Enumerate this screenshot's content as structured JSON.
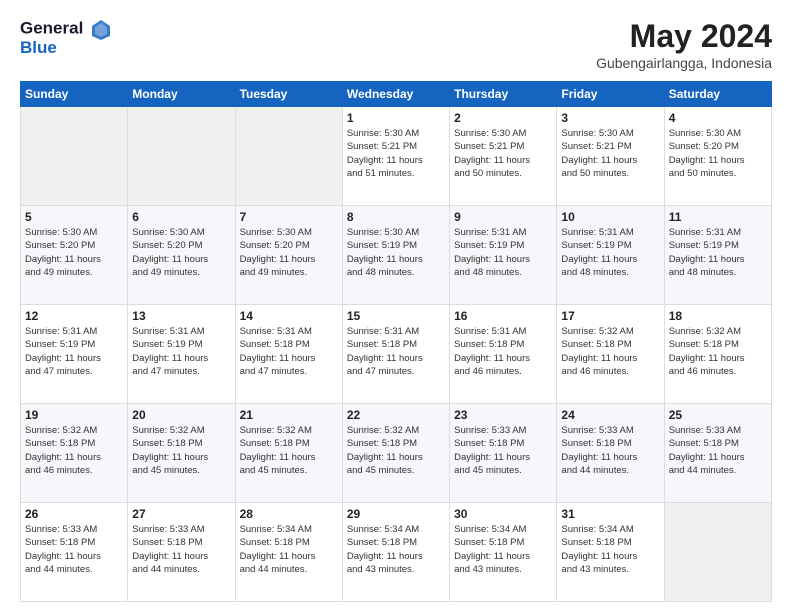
{
  "header": {
    "logo_line1": "General",
    "logo_line2": "Blue",
    "month_year": "May 2024",
    "location": "Gubengairlangga, Indonesia"
  },
  "weekdays": [
    "Sunday",
    "Monday",
    "Tuesday",
    "Wednesday",
    "Thursday",
    "Friday",
    "Saturday"
  ],
  "weeks": [
    [
      {
        "day": "",
        "info": ""
      },
      {
        "day": "",
        "info": ""
      },
      {
        "day": "",
        "info": ""
      },
      {
        "day": "1",
        "info": "Sunrise: 5:30 AM\nSunset: 5:21 PM\nDaylight: 11 hours\nand 51 minutes."
      },
      {
        "day": "2",
        "info": "Sunrise: 5:30 AM\nSunset: 5:21 PM\nDaylight: 11 hours\nand 50 minutes."
      },
      {
        "day": "3",
        "info": "Sunrise: 5:30 AM\nSunset: 5:21 PM\nDaylight: 11 hours\nand 50 minutes."
      },
      {
        "day": "4",
        "info": "Sunrise: 5:30 AM\nSunset: 5:20 PM\nDaylight: 11 hours\nand 50 minutes."
      }
    ],
    [
      {
        "day": "5",
        "info": "Sunrise: 5:30 AM\nSunset: 5:20 PM\nDaylight: 11 hours\nand 49 minutes."
      },
      {
        "day": "6",
        "info": "Sunrise: 5:30 AM\nSunset: 5:20 PM\nDaylight: 11 hours\nand 49 minutes."
      },
      {
        "day": "7",
        "info": "Sunrise: 5:30 AM\nSunset: 5:20 PM\nDaylight: 11 hours\nand 49 minutes."
      },
      {
        "day": "8",
        "info": "Sunrise: 5:30 AM\nSunset: 5:19 PM\nDaylight: 11 hours\nand 48 minutes."
      },
      {
        "day": "9",
        "info": "Sunrise: 5:31 AM\nSunset: 5:19 PM\nDaylight: 11 hours\nand 48 minutes."
      },
      {
        "day": "10",
        "info": "Sunrise: 5:31 AM\nSunset: 5:19 PM\nDaylight: 11 hours\nand 48 minutes."
      },
      {
        "day": "11",
        "info": "Sunrise: 5:31 AM\nSunset: 5:19 PM\nDaylight: 11 hours\nand 48 minutes."
      }
    ],
    [
      {
        "day": "12",
        "info": "Sunrise: 5:31 AM\nSunset: 5:19 PM\nDaylight: 11 hours\nand 47 minutes."
      },
      {
        "day": "13",
        "info": "Sunrise: 5:31 AM\nSunset: 5:19 PM\nDaylight: 11 hours\nand 47 minutes."
      },
      {
        "day": "14",
        "info": "Sunrise: 5:31 AM\nSunset: 5:18 PM\nDaylight: 11 hours\nand 47 minutes."
      },
      {
        "day": "15",
        "info": "Sunrise: 5:31 AM\nSunset: 5:18 PM\nDaylight: 11 hours\nand 47 minutes."
      },
      {
        "day": "16",
        "info": "Sunrise: 5:31 AM\nSunset: 5:18 PM\nDaylight: 11 hours\nand 46 minutes."
      },
      {
        "day": "17",
        "info": "Sunrise: 5:32 AM\nSunset: 5:18 PM\nDaylight: 11 hours\nand 46 minutes."
      },
      {
        "day": "18",
        "info": "Sunrise: 5:32 AM\nSunset: 5:18 PM\nDaylight: 11 hours\nand 46 minutes."
      }
    ],
    [
      {
        "day": "19",
        "info": "Sunrise: 5:32 AM\nSunset: 5:18 PM\nDaylight: 11 hours\nand 46 minutes."
      },
      {
        "day": "20",
        "info": "Sunrise: 5:32 AM\nSunset: 5:18 PM\nDaylight: 11 hours\nand 45 minutes."
      },
      {
        "day": "21",
        "info": "Sunrise: 5:32 AM\nSunset: 5:18 PM\nDaylight: 11 hours\nand 45 minutes."
      },
      {
        "day": "22",
        "info": "Sunrise: 5:32 AM\nSunset: 5:18 PM\nDaylight: 11 hours\nand 45 minutes."
      },
      {
        "day": "23",
        "info": "Sunrise: 5:33 AM\nSunset: 5:18 PM\nDaylight: 11 hours\nand 45 minutes."
      },
      {
        "day": "24",
        "info": "Sunrise: 5:33 AM\nSunset: 5:18 PM\nDaylight: 11 hours\nand 44 minutes."
      },
      {
        "day": "25",
        "info": "Sunrise: 5:33 AM\nSunset: 5:18 PM\nDaylight: 11 hours\nand 44 minutes."
      }
    ],
    [
      {
        "day": "26",
        "info": "Sunrise: 5:33 AM\nSunset: 5:18 PM\nDaylight: 11 hours\nand 44 minutes."
      },
      {
        "day": "27",
        "info": "Sunrise: 5:33 AM\nSunset: 5:18 PM\nDaylight: 11 hours\nand 44 minutes."
      },
      {
        "day": "28",
        "info": "Sunrise: 5:34 AM\nSunset: 5:18 PM\nDaylight: 11 hours\nand 44 minutes."
      },
      {
        "day": "29",
        "info": "Sunrise: 5:34 AM\nSunset: 5:18 PM\nDaylight: 11 hours\nand 43 minutes."
      },
      {
        "day": "30",
        "info": "Sunrise: 5:34 AM\nSunset: 5:18 PM\nDaylight: 11 hours\nand 43 minutes."
      },
      {
        "day": "31",
        "info": "Sunrise: 5:34 AM\nSunset: 5:18 PM\nDaylight: 11 hours\nand 43 minutes."
      },
      {
        "day": "",
        "info": ""
      }
    ]
  ]
}
